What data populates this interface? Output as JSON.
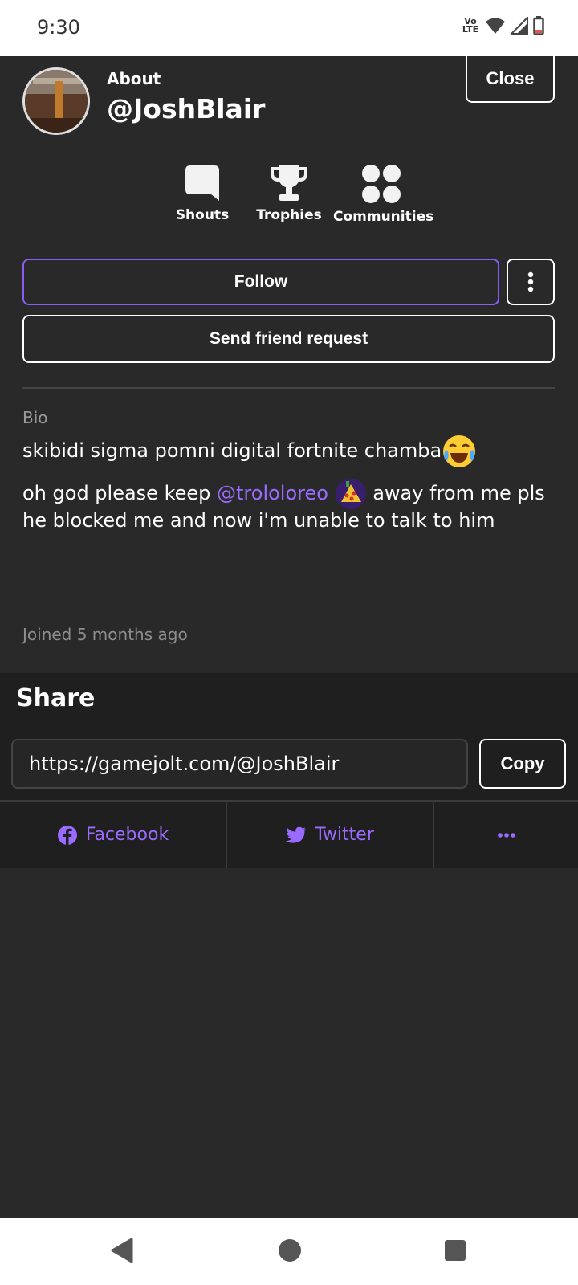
{
  "status": {
    "time": "9:30",
    "volte_top": "Vo",
    "volte_bottom": "LTE"
  },
  "profile": {
    "about_label": "About",
    "username": "@JoshBlair",
    "close_label": "Close",
    "stats": [
      {
        "label": "Shouts",
        "icon": "chat-bubble-icon"
      },
      {
        "label": "Trophies",
        "icon": "trophy-icon"
      },
      {
        "label": "Communities",
        "icon": "communities-icon"
      }
    ],
    "follow_label": "Follow",
    "friend_label": "Send friend request",
    "bio_label": "Bio",
    "bio_line1": "skibidi sigma pomni digital fortnite chamba",
    "bio_line2_pre": "oh god please keep ",
    "bio_mention": "@trololoreo",
    "bio_line2_post": " away from me pls",
    "bio_line3": "he blocked me and now i'm unable to talk to him",
    "joined": "Joined 5 months ago"
  },
  "share": {
    "title": "Share",
    "url": "https://gamejolt.com/@JoshBlair",
    "copy_label": "Copy",
    "facebook_label": "Facebook",
    "twitter_label": "Twitter"
  },
  "colors": {
    "accent": "#9b6bff",
    "follow_border": "#8a5cf5",
    "background": "#292929",
    "share_bg": "#1f1f1f"
  }
}
